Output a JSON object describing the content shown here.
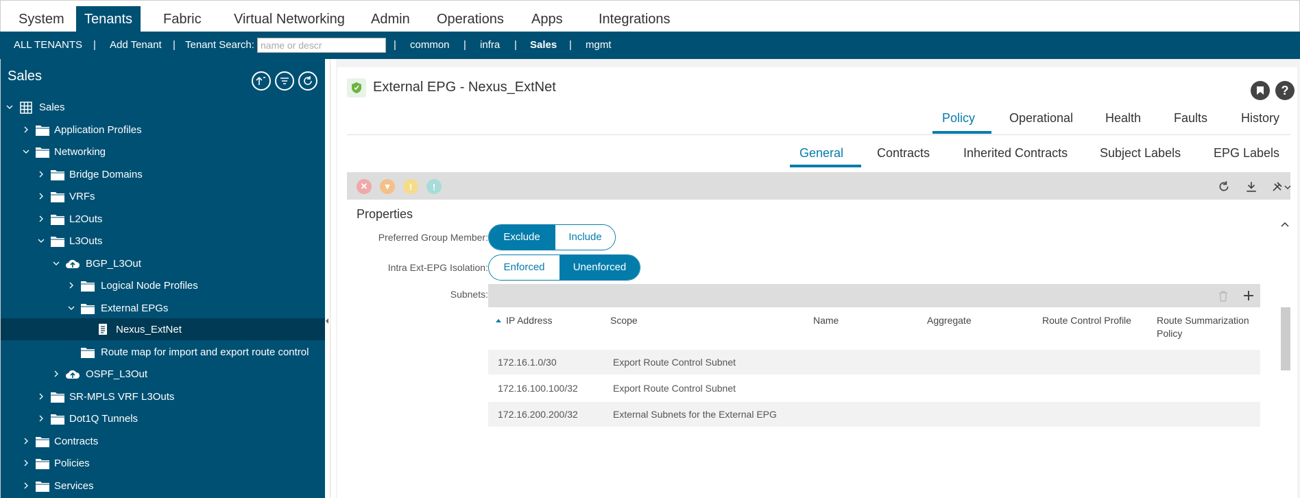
{
  "topnav": {
    "tabs": [
      {
        "label": "System"
      },
      {
        "label": "Tenants"
      },
      {
        "label": "Fabric"
      },
      {
        "label": "Virtual Networking"
      },
      {
        "label": "Admin"
      },
      {
        "label": "Operations"
      },
      {
        "label": "Apps"
      },
      {
        "label": "Integrations"
      }
    ],
    "active": "Tenants"
  },
  "subnav": {
    "all_tenants": "ALL TENANTS",
    "add_tenant": "Add Tenant",
    "tenant_search_label": "Tenant Search:",
    "search_placeholder": "name or descr",
    "tenants": [
      "common",
      "infra",
      "Sales",
      "mgmt"
    ],
    "separator": "|"
  },
  "tree": {
    "title": "Sales",
    "items": [
      {
        "label": "Sales"
      },
      {
        "label": "Application Profiles"
      },
      {
        "label": "Networking"
      },
      {
        "label": "Bridge Domains"
      },
      {
        "label": "VRFs"
      },
      {
        "label": "L2Outs"
      },
      {
        "label": "L3Outs"
      },
      {
        "label": "BGP_L3Out"
      },
      {
        "label": "Logical Node Profiles"
      },
      {
        "label": "External EPGs"
      },
      {
        "label": "Nexus_ExtNet"
      },
      {
        "label": "Route map for import and export route control"
      },
      {
        "label": "OSPF_L3Out"
      },
      {
        "label": "SR-MPLS VRF L3Outs"
      },
      {
        "label": "Dot1Q Tunnels"
      },
      {
        "label": "Contracts"
      },
      {
        "label": "Policies"
      },
      {
        "label": "Services"
      }
    ]
  },
  "main": {
    "title": "External EPG - Nexus_ExtNet",
    "tabs": [
      {
        "label": "Policy"
      },
      {
        "label": "Operational"
      },
      {
        "label": "Health"
      },
      {
        "label": "Faults"
      },
      {
        "label": "History"
      }
    ],
    "subtabs": [
      {
        "label": "General"
      },
      {
        "label": "Contracts"
      },
      {
        "label": "Inherited Contracts"
      },
      {
        "label": "Subject Labels"
      },
      {
        "label": "EPG Labels"
      }
    ],
    "properties_title": "Properties",
    "preferred_group": {
      "label": "Preferred Group Member:",
      "options": [
        "Exclude",
        "Include"
      ],
      "selected": "Exclude"
    },
    "isolation": {
      "label": "Intra Ext-EPG Isolation:",
      "options": [
        "Enforced",
        "Unenforced"
      ],
      "selected": "Unenforced"
    },
    "subnets": {
      "label": "Subnets:",
      "columns": [
        "IP Address",
        "Scope",
        "Name",
        "Aggregate",
        "Route Control Profile",
        "Route Summarization Policy"
      ],
      "rows": [
        {
          "ip": "172.16.1.0/30",
          "scope": "Export Route Control Subnet"
        },
        {
          "ip": "172.16.100.100/32",
          "scope": "Export Route Control Subnet"
        },
        {
          "ip": "172.16.200.200/32",
          "scope": "External Subnets for the External EPG"
        }
      ]
    }
  },
  "colors": {
    "brand": "#005073",
    "accent": "#047cab"
  }
}
